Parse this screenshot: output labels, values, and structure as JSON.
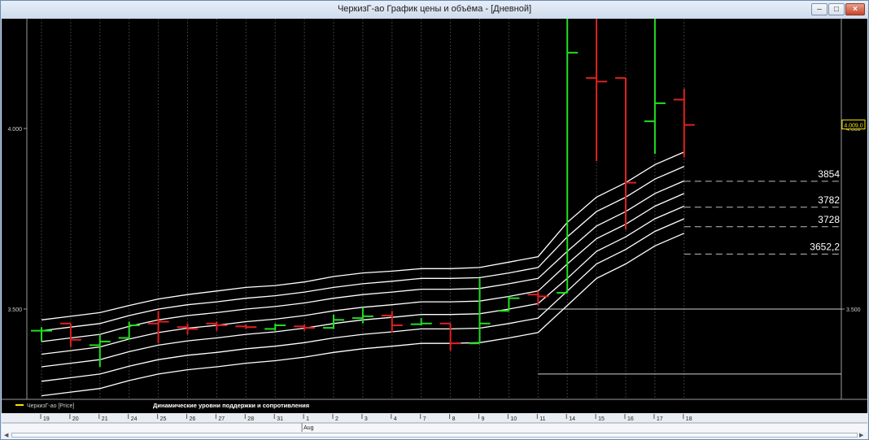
{
  "window": {
    "title": "ЧеркизГ-ао График цены и объёма - [Дневной]",
    "controls": {
      "minimize": "–",
      "maximize": "□",
      "close": "×"
    }
  },
  "colors": {
    "up": "#22dd22",
    "down": "#e02020",
    "band": "#ffffff",
    "background": "#000000",
    "legend_swatch": "#f2e600"
  },
  "legend": {
    "series": "ЧеркизГ-ао [Price]",
    "indicator": "Динамические уровни поддержки и  сопротивления"
  },
  "chart_data": {
    "type": "ohlc",
    "ylim": [
      3300,
      4300
    ],
    "y_ticks": [
      {
        "value": 4000,
        "label": "4.000"
      },
      {
        "value": 3500,
        "label": "3.500"
      }
    ],
    "last_price_label": "4.009,0",
    "x_labels": [
      "19",
      "20",
      "21",
      "24",
      "25",
      "26",
      "27",
      "28",
      "31",
      "1",
      "2",
      "3",
      "4",
      "7",
      "8",
      "9",
      "10",
      "11",
      "14",
      "15",
      "16",
      "17",
      "18"
    ],
    "month_label": "Aug",
    "bars": [
      {
        "o": 3440,
        "h": 3450,
        "l": 3410,
        "c": 3440,
        "dir": "up"
      },
      {
        "o": 3460,
        "h": 3460,
        "l": 3395,
        "c": 3415,
        "dir": "down"
      },
      {
        "o": 3400,
        "h": 3430,
        "l": 3340,
        "c": 3410,
        "dir": "up"
      },
      {
        "o": 3420,
        "h": 3465,
        "l": 3415,
        "c": 3455,
        "dir": "up"
      },
      {
        "o": 3460,
        "h": 3495,
        "l": 3405,
        "c": 3465,
        "dir": "down"
      },
      {
        "o": 3450,
        "h": 3460,
        "l": 3430,
        "c": 3445,
        "dir": "down"
      },
      {
        "o": 3460,
        "h": 3465,
        "l": 3440,
        "c": 3455,
        "dir": "down"
      },
      {
        "o": 3452,
        "h": 3458,
        "l": 3445,
        "c": 3450,
        "dir": "down"
      },
      {
        "o": 3445,
        "h": 3460,
        "l": 3440,
        "c": 3455,
        "dir": "up"
      },
      {
        "o": 3452,
        "h": 3458,
        "l": 3440,
        "c": 3448,
        "dir": "down"
      },
      {
        "o": 3448,
        "h": 3485,
        "l": 3445,
        "c": 3470,
        "dir": "up"
      },
      {
        "o": 3475,
        "h": 3505,
        "l": 3460,
        "c": 3480,
        "dir": "up"
      },
      {
        "o": 3482,
        "h": 3495,
        "l": 3435,
        "c": 3455,
        "dir": "down"
      },
      {
        "o": 3458,
        "h": 3475,
        "l": 3455,
        "c": 3460,
        "dir": "up"
      },
      {
        "o": 3460,
        "h": 3460,
        "l": 3385,
        "c": 3405,
        "dir": "down"
      },
      {
        "o": 3405,
        "h": 3585,
        "l": 3405,
        "c": 3460,
        "dir": "up"
      },
      {
        "o": 3495,
        "h": 3535,
        "l": 3495,
        "c": 3530,
        "dir": "up"
      },
      {
        "o": 3540,
        "h": 3550,
        "l": 3510,
        "c": 3535,
        "dir": "down"
      },
      {
        "o": 3545,
        "h": 4410,
        "l": 3545,
        "c": 4210,
        "dir": "up"
      },
      {
        "o": 4140,
        "h": 4410,
        "l": 3910,
        "c": 4130,
        "dir": "down"
      },
      {
        "o": 4140,
        "h": 4140,
        "l": 3720,
        "c": 3850,
        "dir": "down"
      },
      {
        "o": 4020,
        "h": 4410,
        "l": 3930,
        "c": 4070,
        "dir": "up"
      },
      {
        "o": 4080,
        "h": 4110,
        "l": 3920,
        "c": 4010,
        "dir": "down"
      }
    ],
    "band_lines": [
      [
        3470,
        3480,
        3490,
        3510,
        3528,
        3540,
        3550,
        3560,
        3565,
        3575,
        3590,
        3600,
        3605,
        3612,
        3612,
        3615,
        3630,
        3645,
        3740,
        3810,
        3850,
        3900,
        3935
      ],
      [
        3440,
        3450,
        3460,
        3482,
        3500,
        3512,
        3520,
        3530,
        3537,
        3547,
        3560,
        3570,
        3577,
        3585,
        3585,
        3587,
        3600,
        3615,
        3700,
        3770,
        3810,
        3860,
        3895
      ],
      [
        3410,
        3420,
        3430,
        3452,
        3470,
        3482,
        3490,
        3500,
        3507,
        3517,
        3530,
        3540,
        3547,
        3555,
        3555,
        3557,
        3570,
        3585,
        3660,
        3730,
        3770,
        3820,
        3855
      ],
      [
        3375,
        3385,
        3395,
        3417,
        3435,
        3447,
        3455,
        3465,
        3472,
        3482,
        3495,
        3505,
        3512,
        3520,
        3520,
        3522,
        3535,
        3550,
        3625,
        3695,
        3735,
        3785,
        3820
      ],
      [
        3340,
        3350,
        3360,
        3382,
        3400,
        3412,
        3420,
        3430,
        3437,
        3447,
        3460,
        3470,
        3477,
        3485,
        3485,
        3487,
        3500,
        3515,
        3585,
        3660,
        3700,
        3750,
        3785
      ],
      [
        3300,
        3310,
        3320,
        3342,
        3360,
        3372,
        3380,
        3390,
        3397,
        3407,
        3420,
        3430,
        3437,
        3445,
        3445,
        3447,
        3460,
        3475,
        3550,
        3625,
        3665,
        3715,
        3750
      ],
      [
        3260,
        3270,
        3280,
        3302,
        3320,
        3332,
        3340,
        3350,
        3357,
        3367,
        3380,
        3390,
        3397,
        3405,
        3405,
        3407,
        3420,
        3435,
        3510,
        3585,
        3625,
        3675,
        3710
      ]
    ],
    "levels": [
      {
        "value": 3854,
        "label": "3854"
      },
      {
        "value": 3782,
        "label": "3782"
      },
      {
        "value": 3728,
        "label": "3728"
      },
      {
        "value": 3652.2,
        "label": "3652,2"
      }
    ],
    "ref_lines": [
      3500,
      3320
    ]
  }
}
